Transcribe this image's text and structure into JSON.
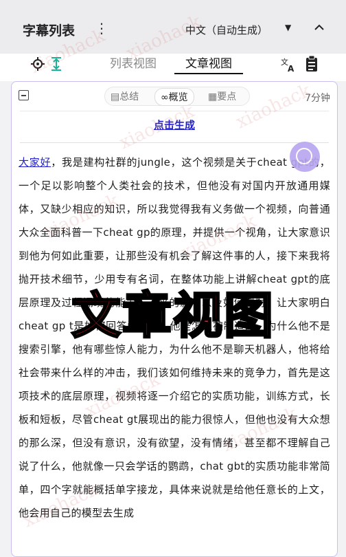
{
  "header": {
    "title": "字幕列表",
    "language": "中文（自动生成）"
  },
  "view_tabs": {
    "list_view": "列表视图",
    "article_view": "文章视图",
    "active": "文章视图"
  },
  "summary": {
    "tabs": [
      "总结",
      "概览",
      "要点"
    ],
    "active": "概览",
    "duration": "7分钟",
    "generate_link": "点击生成"
  },
  "article": {
    "link_text": "大家好",
    "body": "，我是建构社群的jungle，这个视频是关于cheat gpt的，一个足以影响整个人类社会的技术，但他没有对国内开放通用媒体，又缺少相应的知识，所以我觉得我有义务做一个视频，向普通大众全面科普一下cheat gp的原理，并提供一个视角，让大家意识到他为何如此重要，让那些没有机会了解这件事的人，接下来我将抛开技术细节，少用专有名词，在整体功能上讲解cheat gpt的底层原理及过程涌现的能力，未来的影响以及如何应对，让大家明白cheat gp t是如何回答问题的，他是怎么被制造的，为什么他不是搜索引擎，他有哪些惊人能力，为什么他不是聊天机器人，他将给社会带来什么样的冲击，我们该如何维持未来的竞争力，首先是这项技术的底层原理，视频将逐一介绍它的实质功能，训练方式，长板和短板，尽管cheat gt展现出的能力很惊人，但他也没有大众想的那么深，但没有意识，没有欲望，没有情绪，甚至都不理解自己说了什么，他就像一只会学话的鹦鹉，chat gbt的实质功能非常简单，四个字就能概括单字接龙，具体来说就是给他任意长的上文，他会用自己的模型去生成"
  },
  "overlay_caption": "文章视图",
  "watermark": "xiaohack",
  "colors": {
    "accent_link": "#2222cc",
    "panel_border": "#c9bdf1",
    "float_button": "#b7a6f0",
    "overlay_fill": "#ff1f1f",
    "icon_teal": "#16b39a"
  },
  "icons": {
    "menu": "kebab-icon",
    "dropdown": "caret-down-icon",
    "collapse": "chevron-up-icon",
    "locate": "crosshair-icon",
    "expand": "vertical-expand-icon",
    "translate": "translate-icon",
    "clipboard": "clipboard-icon",
    "summary": "document-icon",
    "overview": "glasses-icon",
    "keypoints": "clipboard-small-icon",
    "float": "scroll-anchor-icon"
  }
}
